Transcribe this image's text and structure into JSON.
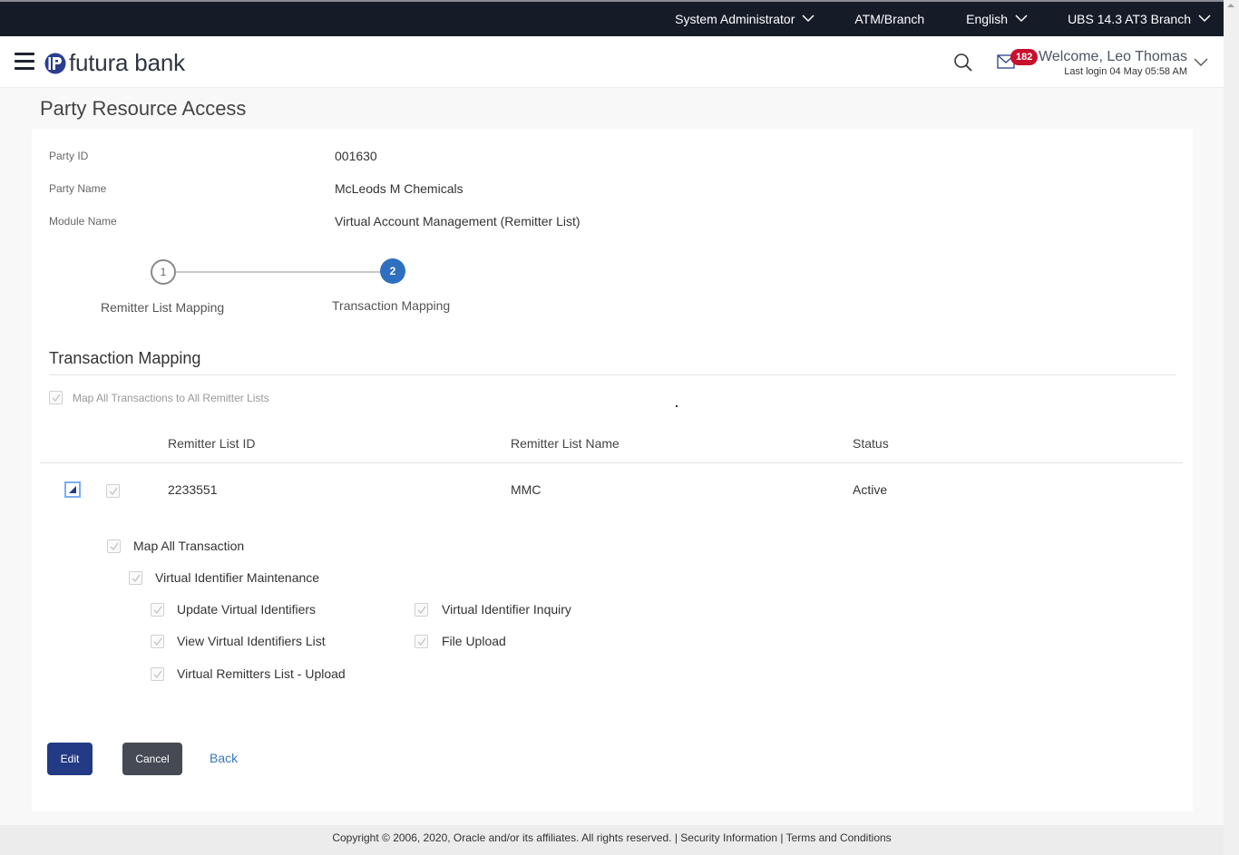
{
  "topbar": {
    "role": "System Administrator",
    "atm_branch": "ATM/Branch",
    "language": "English",
    "branch": "UBS 14.3 AT3 Branch"
  },
  "header": {
    "logo_text": "futura bank",
    "notification_count": "182",
    "welcome": "Welcome, Leo Thomas",
    "last_login": "Last login 04 May 05:58 AM"
  },
  "page_title": "Party Resource Access",
  "info": {
    "party_id_label": "Party ID",
    "party_id": "001630",
    "party_name_label": "Party Name",
    "party_name": "McLeods M Chemicals",
    "module_name_label": "Module Name",
    "module_name": "Virtual Account Management (Remitter List)"
  },
  "stepper": {
    "steps": [
      {
        "number": "1",
        "label": "Remitter List Mapping",
        "active": false
      },
      {
        "number": "2",
        "label": "Transaction Mapping",
        "active": true
      }
    ]
  },
  "section": {
    "title": "Transaction Mapping",
    "map_all_label": "Map All Transactions to All Remitter Lists",
    "map_all_checked": true
  },
  "table": {
    "columns": [
      "Remitter List ID",
      "Remitter List Name",
      "Status"
    ],
    "rows": [
      {
        "id": "2233551",
        "name": "MMC",
        "status": "Active",
        "checked": true,
        "expanded": true
      }
    ]
  },
  "transactions": {
    "map_all_label": "Map All Transaction",
    "group_label": "Virtual Identifier Maintenance",
    "items": [
      {
        "label": "Update Virtual Identifiers",
        "checked": true
      },
      {
        "label": "Virtual Identifier Inquiry",
        "checked": true
      },
      {
        "label": "View Virtual Identifiers List",
        "checked": true
      },
      {
        "label": "File Upload",
        "checked": true
      },
      {
        "label": "Virtual Remitters List - Upload",
        "checked": true
      }
    ]
  },
  "buttons": {
    "edit": "Edit",
    "cancel": "Cancel",
    "back": "Back"
  },
  "footer": {
    "copyright": "Copyright © 2006, 2020, Oracle and/or its affiliates. All rights reserved.",
    "security": "Security Information",
    "terms": "Terms and Conditions",
    "separator": "|"
  },
  "colors": {
    "topbar_bg": "#161b28",
    "primary": "#233a84",
    "step_active": "#2f6fbf",
    "badge": "#c8102e",
    "link": "#3a78b8"
  }
}
